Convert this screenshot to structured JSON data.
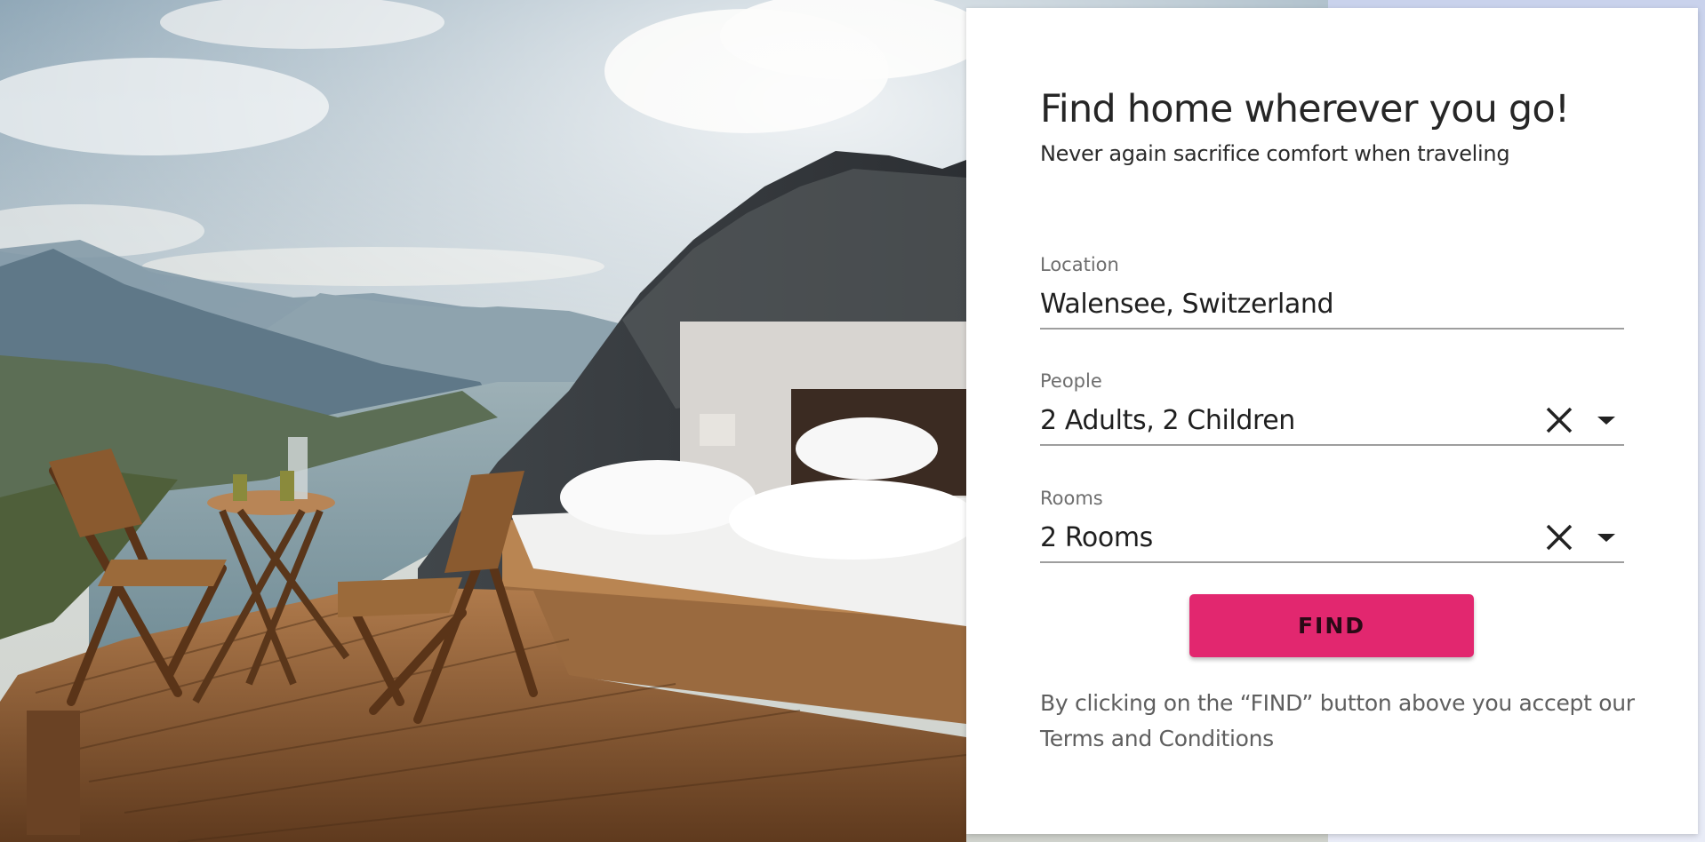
{
  "hero": {
    "image_alt": "Outdoor bed and table on a wooden deck overlooking a mountain lake"
  },
  "search_card": {
    "title": "Find home wherever you go!",
    "subtitle": "Never again sacrifice comfort when traveling",
    "location": {
      "label": "Location",
      "value": "Walensee, Switzerland"
    },
    "people": {
      "label": "People",
      "value": "2 Adults, 2 Children"
    },
    "rooms": {
      "label": "Rooms",
      "value": "2 Rooms"
    },
    "find_button": "FIND",
    "terms_prefix": "By clicking on the “FIND” button above you accept our",
    "terms_link": "Terms and Conditions"
  },
  "colors": {
    "accent": "#e2276f",
    "card_background": "#ffffff",
    "text_primary": "#262626",
    "text_secondary": "#6e6e6e"
  },
  "icons": {
    "clear": "close-icon",
    "dropdown": "caret-down-icon"
  }
}
